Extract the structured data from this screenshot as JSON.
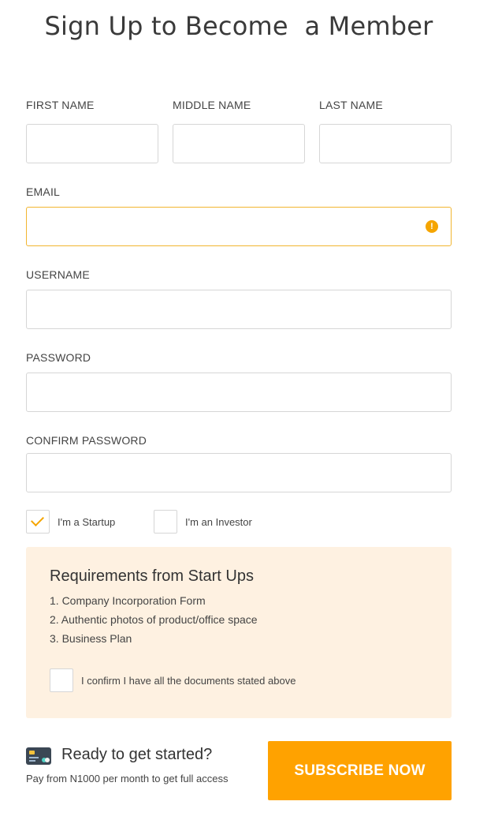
{
  "page": {
    "title": "Sign Up to Become  a Member"
  },
  "form": {
    "first_name": {
      "label": "FIRST NAME",
      "value": ""
    },
    "middle_name": {
      "label": "MIDDLE NAME",
      "value": ""
    },
    "last_name": {
      "label": "LAST NAME",
      "value": ""
    },
    "email": {
      "label": "EMAIL",
      "value": "",
      "status": "warning"
    },
    "username": {
      "label": "USERNAME",
      "value": ""
    },
    "password": {
      "label": "PASSWORD",
      "value": ""
    },
    "confirm_password": {
      "label": "CONFIRM PASSWORD",
      "value": ""
    }
  },
  "role": {
    "startup": {
      "label": "I'm a Startup",
      "checked": true
    },
    "investor": {
      "label": "I'm an Investor",
      "checked": false
    }
  },
  "requirements": {
    "title": "Requirements from Start Ups",
    "items": [
      "1. Company Incorporation Form",
      "2. Authentic photos of product/office space",
      "3. Business Plan"
    ],
    "confirm_label": "I confirm I have all the documents stated above",
    "confirm_checked": false
  },
  "cta": {
    "icon": "credit-card-icon",
    "title": "Ready to get started?",
    "subtitle": "Pay from N1000 per month to get full access",
    "button_label": "SUBSCRIBE NOW"
  },
  "colors": {
    "accent": "#ffa200",
    "warning_border": "#f2b530",
    "panel_bg": "#fef1e1"
  }
}
